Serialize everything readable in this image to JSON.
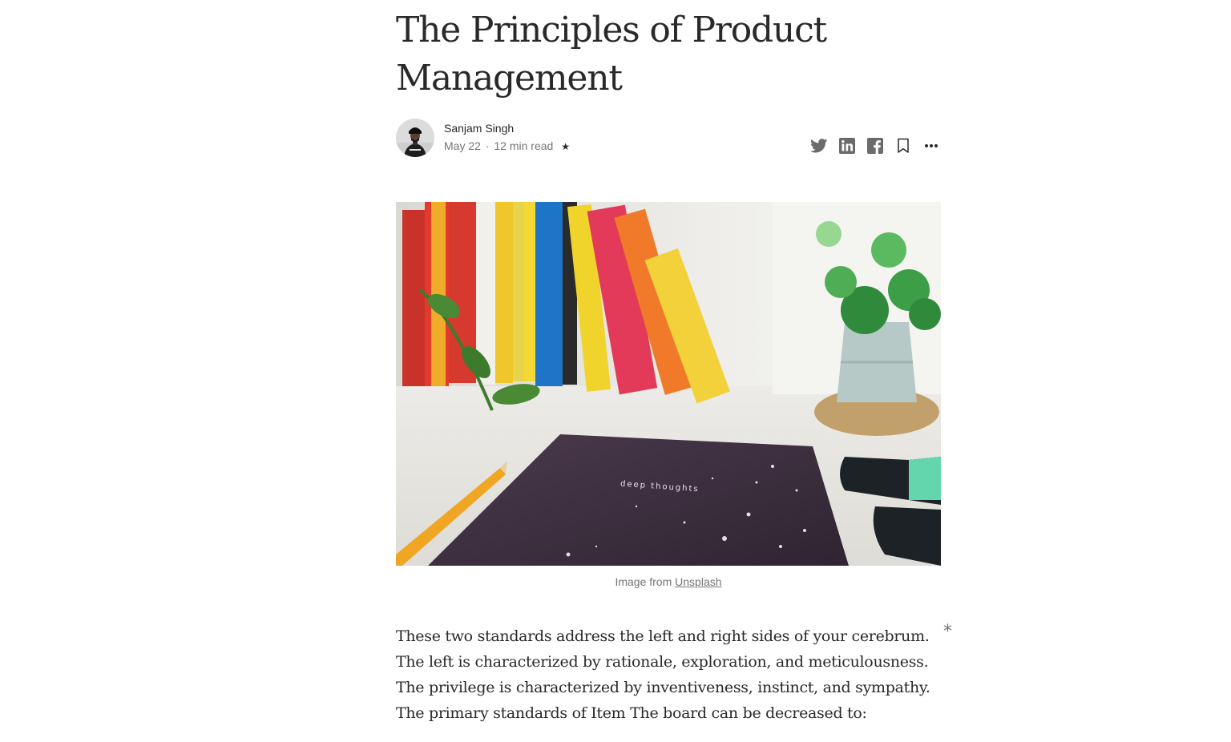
{
  "article": {
    "title": "The Principles of Product Management",
    "author": "Sanjam Singh",
    "date": "May 22",
    "separator": "·",
    "read_time": "12 min read",
    "member_star": "★"
  },
  "actions": {
    "twitter": "twitter-icon",
    "linkedin": "linkedin-icon",
    "facebook": "facebook-icon",
    "bookmark": "bookmark-icon",
    "more": "more-icon"
  },
  "figure": {
    "notebook_text": "deep thoughts",
    "caption_prefix": "Image from",
    "caption_link": "Unsplash"
  },
  "body": {
    "paragraph": "These two standards address the left and right sides of your cerebrum. The left is characterized by rationale, exploration, and meticulousness. The privilege is characterized by inventiveness, instinct, and sympathy. The primary standards of Item The board can be decreased to:"
  },
  "side_marker": "*",
  "colors": {
    "text": "#292929",
    "muted": "#757575",
    "background": "#ffffff"
  }
}
